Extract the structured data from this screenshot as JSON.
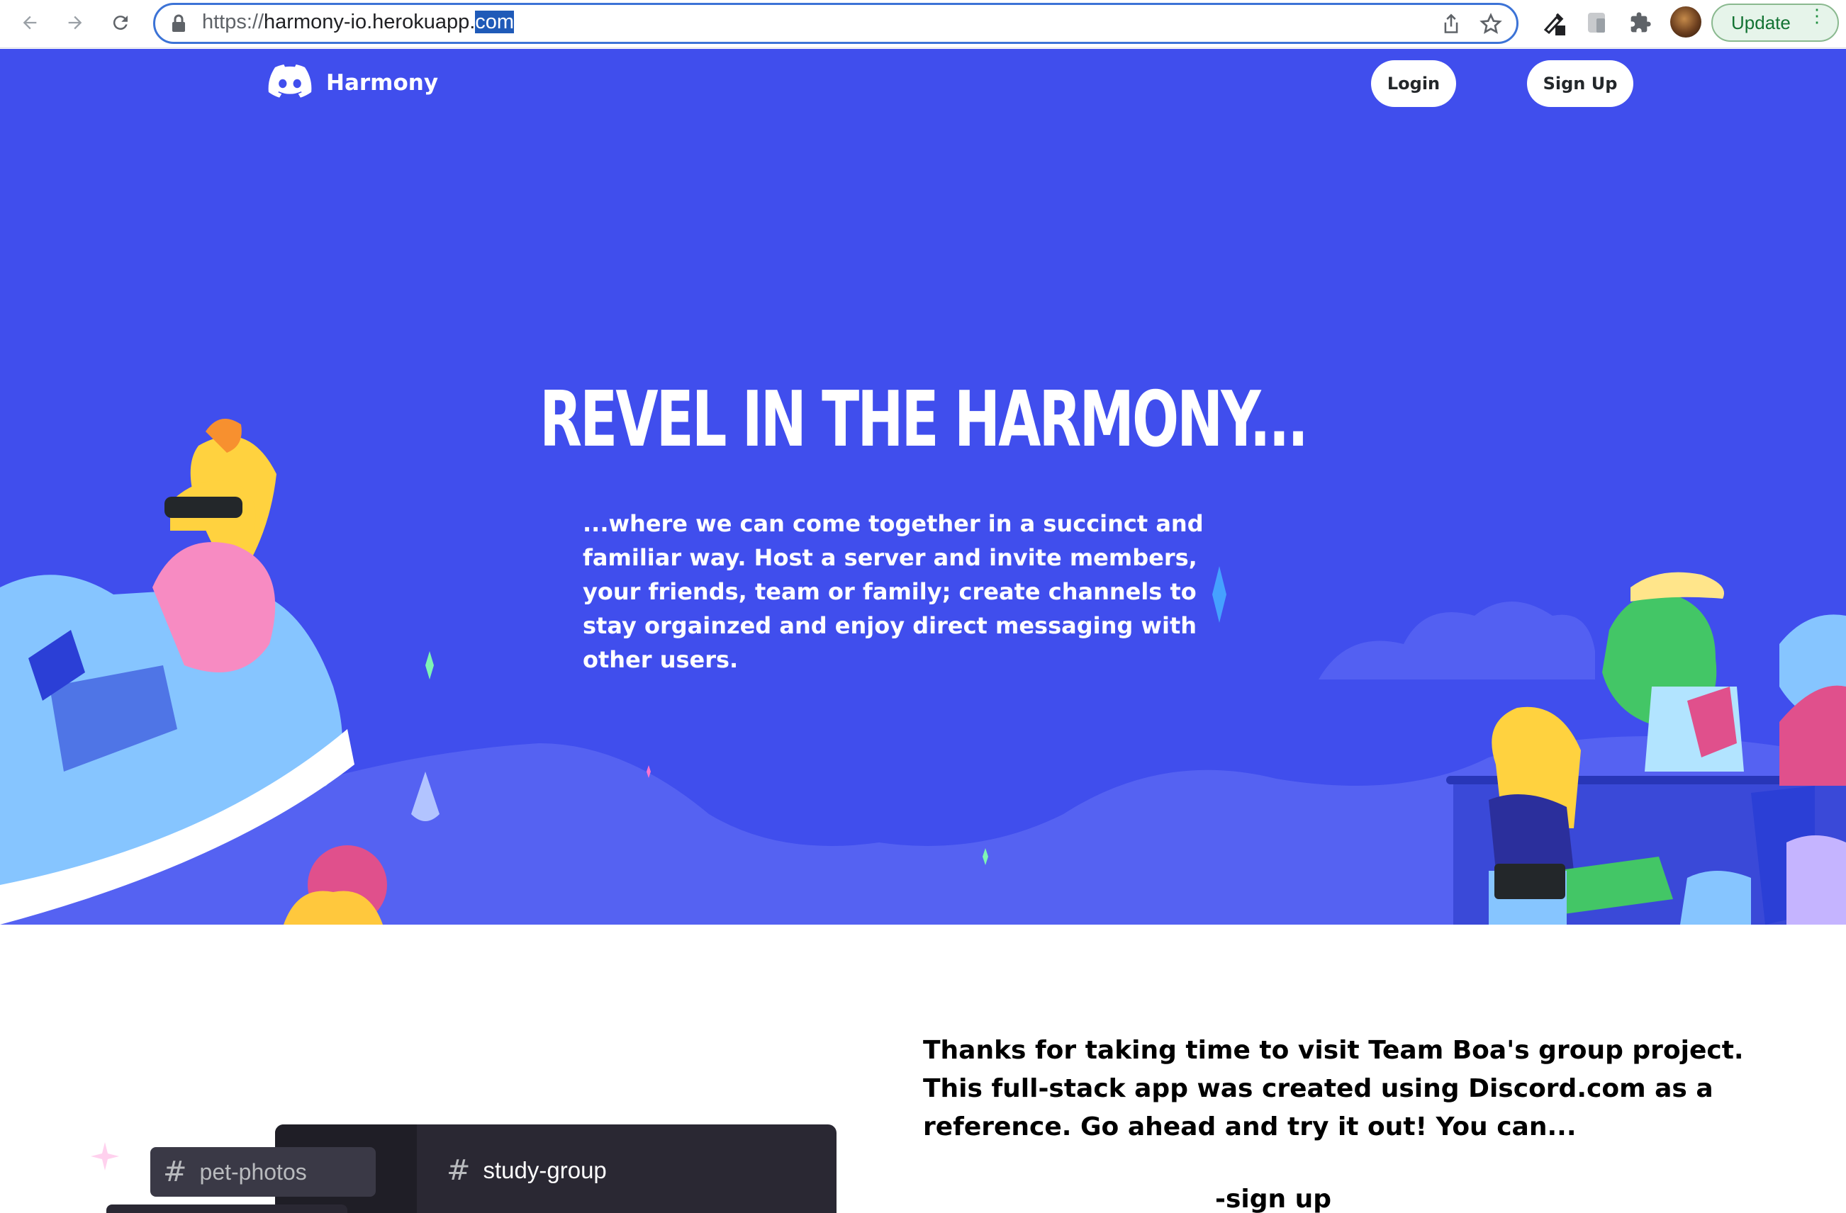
{
  "browser": {
    "url_prefix": "https://",
    "url_host": "harmony-io.herokuapp.",
    "url_selected": "com",
    "update_label": "Update"
  },
  "nav": {
    "brand": "Harmony",
    "login": "Login",
    "signup": "Sign Up"
  },
  "hero": {
    "title": "REVEL IN THE HARMONY...",
    "description": "...where we can come together in a succinct and familiar way. Host a server and invite members, your friends, team or family; create channels to stay orgainzed and enjoy direct messaging with other users."
  },
  "about": {
    "text": "Thanks for taking time to visit Team Boa's group project. This full-stack app was created using Discord.com as a reference. Go ahead and try it out! You can...",
    "signup_link": "-sign up"
  },
  "preview": {
    "channels": [
      "pet-photos",
      "study-group"
    ]
  },
  "colors": {
    "hero_bg": "#404eed",
    "omnibox_border": "#3c73d6"
  }
}
